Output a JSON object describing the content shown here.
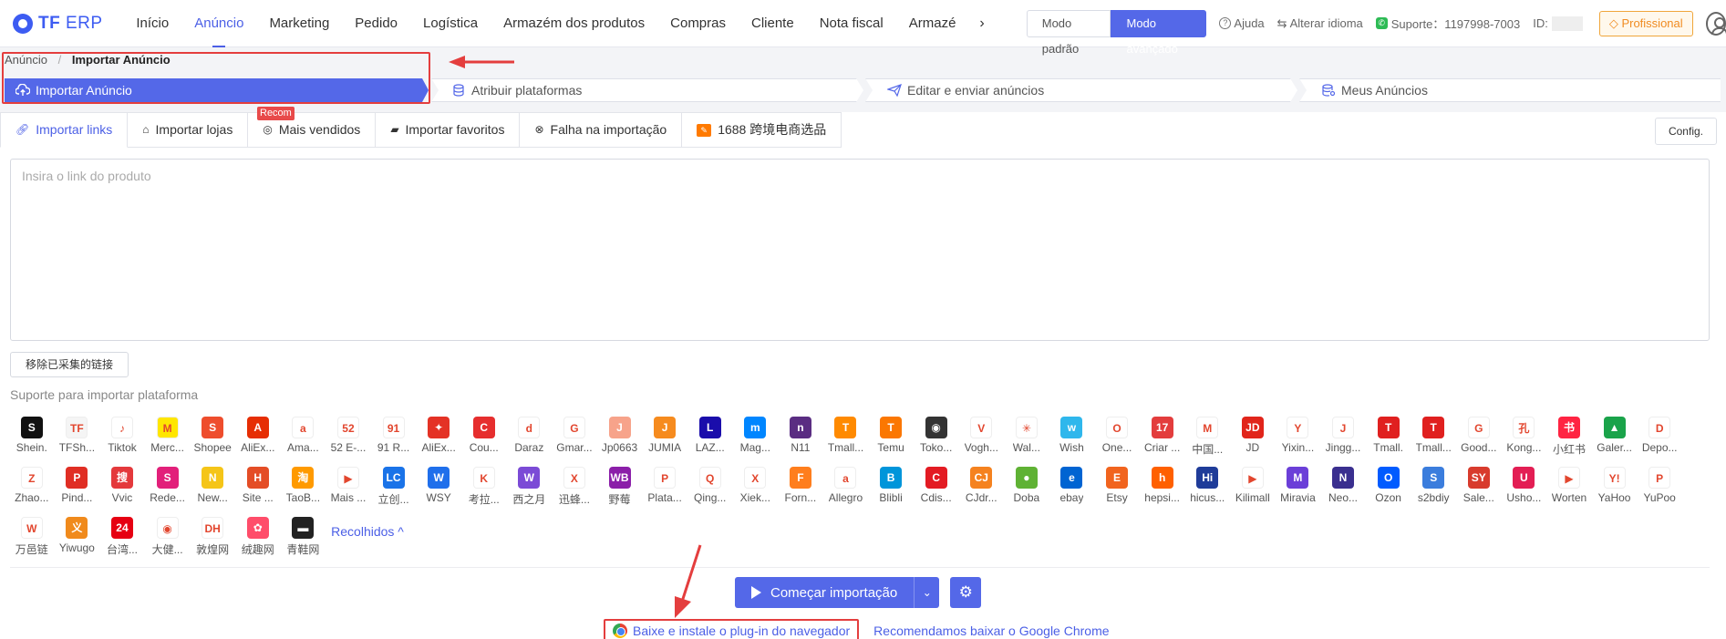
{
  "header": {
    "logo_brand": "TF",
    "logo_suffix": "ERP",
    "nav": [
      "Início",
      "Anúncio",
      "Marketing",
      "Pedido",
      "Logística",
      "Armazém dos produtos",
      "Compras",
      "Cliente",
      "Nota fiscal",
      "Armazé"
    ],
    "nav_active_index": 1,
    "mode_standard": "Modo padrão",
    "mode_advanced": "Modo avançado",
    "help": "Ajuda",
    "language": "Alterar idioma",
    "support": "Suporte：1197998-7003",
    "id_label": "ID:",
    "plan": "Profissional"
  },
  "breadcrumb": {
    "parent": "Anúncio",
    "separator": "/",
    "current": "Importar Anúncio"
  },
  "steps": [
    "Importar Anúncio",
    "Atribuir plataformas",
    "Editar e enviar anúncios",
    "Meus Anúncios"
  ],
  "badge_recommend": "Recom",
  "tabs": [
    "Importar links",
    "Importar lojas",
    "Mais vendidos",
    "Importar favoritos",
    "Falha na importação",
    "1688 跨境电商选品"
  ],
  "config_label": "Config.",
  "link_input": {
    "placeholder": "Insira o link do produto",
    "value": ""
  },
  "remove_collected_label": "移除已采集的链接",
  "support_title": "Suporte para importar plataforma",
  "platforms_row1": [
    {
      "name": "Shein.",
      "color": "#111111",
      "glyph": "S"
    },
    {
      "name": "TFSh...",
      "color": "#f5f5f5",
      "glyph": "TF"
    },
    {
      "name": "Tiktok",
      "color": "#ffffff",
      "glyph": "♪"
    },
    {
      "name": "Merc...",
      "color": "#ffe600",
      "glyph": "M"
    },
    {
      "name": "Shopee",
      "color": "#ee4d2d",
      "glyph": "S"
    },
    {
      "name": "AliEx...",
      "color": "#e62e04",
      "glyph": "A"
    },
    {
      "name": "Ama...",
      "color": "#ffffff",
      "glyph": "a"
    },
    {
      "name": "52 E-...",
      "color": "#ffffff",
      "glyph": "52"
    },
    {
      "name": "91 R...",
      "color": "#ffffff",
      "glyph": "91"
    },
    {
      "name": "AliEx...",
      "color": "#e43225",
      "glyph": "✦"
    },
    {
      "name": "Cou...",
      "color": "#e62e2e",
      "glyph": "C"
    },
    {
      "name": "Daraz",
      "color": "#ffffff",
      "glyph": "d"
    },
    {
      "name": "Gmar...",
      "color": "#ffffff",
      "glyph": "G"
    },
    {
      "name": "Jp0663",
      "color": "#f7a38a",
      "glyph": "J"
    },
    {
      "name": "JUMIA",
      "color": "#f68b1e",
      "glyph": "J"
    },
    {
      "name": "LAZ...",
      "color": "#1a0dab",
      "glyph": "L"
    },
    {
      "name": "Mag...",
      "color": "#0086ff",
      "glyph": "m"
    },
    {
      "name": "N11",
      "color": "#5a2d82",
      "glyph": "n"
    },
    {
      "name": "Tmall...",
      "color": "#ff8a00",
      "glyph": "T"
    },
    {
      "name": "Temu",
      "color": "#fb7701",
      "glyph": "T"
    },
    {
      "name": "Toko...",
      "color": "#333333",
      "glyph": "◉"
    },
    {
      "name": "Vogh...",
      "color": "#ffffff",
      "glyph": "V"
    },
    {
      "name": "Wal...",
      "color": "#ffffff",
      "glyph": "✳"
    },
    {
      "name": "Wish",
      "color": "#2fb7ec",
      "glyph": "w"
    },
    {
      "name": "One...",
      "color": "#ffffff",
      "glyph": "O"
    },
    {
      "name": "Criar ...",
      "color": "#e33d3d",
      "glyph": "17"
    },
    {
      "name": "中国...",
      "color": "#ffffff",
      "glyph": "M"
    },
    {
      "name": "JD",
      "color": "#e1251b",
      "glyph": "JD"
    },
    {
      "name": "Yixin...",
      "color": "#ffffff",
      "glyph": "Y"
    },
    {
      "name": "Jingg...",
      "color": "#ffffff",
      "glyph": "J"
    },
    {
      "name": "Tmall.",
      "color": "#e0201f",
      "glyph": "T"
    },
    {
      "name": "Tmall...",
      "color": "#e0201f",
      "glyph": "T"
    },
    {
      "name": "Good...",
      "color": "#ffffff",
      "glyph": "G"
    },
    {
      "name": "Kong...",
      "color": "#ffffff",
      "glyph": "孔"
    },
    {
      "name": "小红书",
      "color": "#ff2442",
      "glyph": "书"
    },
    {
      "name": "Galer...",
      "color": "#1aa34a",
      "glyph": "▲"
    },
    {
      "name": "Depo...",
      "color": "#ffffff",
      "glyph": "D"
    }
  ],
  "platforms_row2": [
    {
      "name": "Zhao...",
      "color": "#ffffff",
      "glyph": "Z"
    },
    {
      "name": "Pind...",
      "color": "#e02e24",
      "glyph": "P"
    },
    {
      "name": "Vvic",
      "color": "#e4393c",
      "glyph": "搜"
    },
    {
      "name": "Rede...",
      "color": "#e2207a",
      "glyph": "S"
    },
    {
      "name": "New...",
      "color": "#f5c518",
      "glyph": "N"
    },
    {
      "name": "Site ...",
      "color": "#e44d26",
      "glyph": "H"
    },
    {
      "name": "TaoB...",
      "color": "#ff9a00",
      "glyph": "淘"
    },
    {
      "name": "Mais ...",
      "color": "#ffffff",
      "glyph": "▶"
    },
    {
      "name": "立创...",
      "color": "#1a73e8",
      "glyph": "LC"
    },
    {
      "name": "WSY",
      "color": "#1f6feb",
      "glyph": "W"
    },
    {
      "name": "考拉...",
      "color": "#ffffff",
      "glyph": "K"
    },
    {
      "name": "西之月",
      "color": "#7b4bd6",
      "glyph": "W"
    },
    {
      "name": "迅蜂...",
      "color": "#ffffff",
      "glyph": "X"
    },
    {
      "name": "野莓",
      "color": "#8b1fa9",
      "glyph": "WB"
    },
    {
      "name": "Plata...",
      "color": "#ffffff",
      "glyph": "P"
    },
    {
      "name": "Qing...",
      "color": "#ffffff",
      "glyph": "Q"
    },
    {
      "name": "Xiek...",
      "color": "#ffffff",
      "glyph": "X"
    },
    {
      "name": "Forn...",
      "color": "#ff7e1d",
      "glyph": "F"
    },
    {
      "name": "Allegro",
      "color": "#ffffff",
      "glyph": "a"
    },
    {
      "name": "Blibli",
      "color": "#0095da",
      "glyph": "B"
    },
    {
      "name": "Cdis...",
      "color": "#e31b23",
      "glyph": "C"
    },
    {
      "name": "CJdr...",
      "color": "#f5821f",
      "glyph": "CJ"
    },
    {
      "name": "Doba",
      "color": "#5fb234",
      "glyph": "●"
    },
    {
      "name": "ebay",
      "color": "#0064d2",
      "glyph": "e"
    },
    {
      "name": "Etsy",
      "color": "#f1641e",
      "glyph": "E"
    },
    {
      "name": "hepsi...",
      "color": "#ff6000",
      "glyph": "h"
    },
    {
      "name": "hicus...",
      "color": "#1f3c99",
      "glyph": "Hi"
    },
    {
      "name": "Kilimall",
      "color": "#ffffff",
      "glyph": "▶"
    },
    {
      "name": "Miravia",
      "color": "#6b3fd8",
      "glyph": "M"
    },
    {
      "name": "Neo...",
      "color": "#3a2f8f",
      "glyph": "N"
    },
    {
      "name": "Ozon",
      "color": "#005bff",
      "glyph": "O"
    },
    {
      "name": "s2bdiy",
      "color": "#3b7ddd",
      "glyph": "S"
    },
    {
      "name": "Sale...",
      "color": "#d83b2d",
      "glyph": "SY"
    },
    {
      "name": "Usho...",
      "color": "#e31e54",
      "glyph": "U"
    },
    {
      "name": "Worten",
      "color": "#ffffff",
      "glyph": "▶"
    },
    {
      "name": "YaHoo",
      "color": "#ffffff",
      "glyph": "Y!"
    },
    {
      "name": "YuPoo",
      "color": "#ffffff",
      "glyph": "P"
    }
  ],
  "platforms_row3": [
    {
      "name": "万邑链",
      "color": "#ffffff",
      "glyph": "W"
    },
    {
      "name": "Yiwugo",
      "color": "#f08a1c",
      "glyph": "义"
    },
    {
      "name": "台湾...",
      "color": "#e60012",
      "glyph": "24"
    },
    {
      "name": "大健...",
      "color": "#ffffff",
      "glyph": "◉"
    },
    {
      "name": "敦煌网",
      "color": "#ffffff",
      "glyph": "DH"
    },
    {
      "name": "绒趣网",
      "color": "#ff4d6a",
      "glyph": "✿"
    },
    {
      "name": "青鞋网",
      "color": "#222222",
      "glyph": "▬"
    }
  ],
  "collapsed_label": "Recolhidos ^",
  "start_button": "Começar importação",
  "download_plugin": "Baixe e instale o plug-in do navegador",
  "recommend_chrome": "Recomendamos baixar o Google Chrome",
  "colors": {
    "primary": "#5468e8",
    "annotation_red": "#e43e3e",
    "pro": "#f08c22"
  }
}
